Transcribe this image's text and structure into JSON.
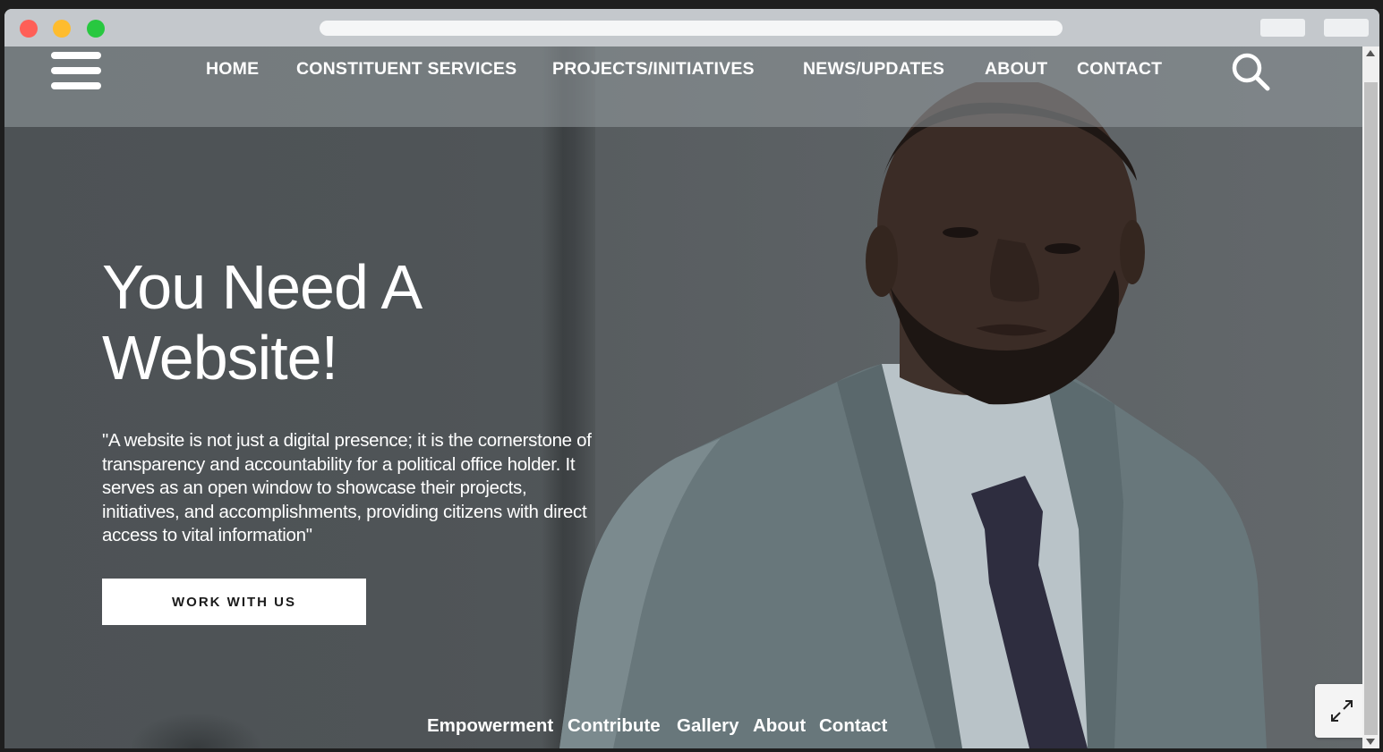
{
  "nav": {
    "items": [
      "HOME",
      "CONSTITUENT SERVICES",
      "PROJECTS/INITIATIVES",
      "NEWS/UPDATES",
      "ABOUT",
      "CONTACT"
    ]
  },
  "hero": {
    "title": "You Need A Website!",
    "quote": "\"A website is not just a digital presence; it is the cornerstone of transparency and accountability for a political office holder. It serves as an open window to showcase their projects, initiatives, and accomplishments, providing citizens with direct access to vital information\"",
    "cta_label": "WORK WITH US"
  },
  "footer": {
    "links": [
      "Empowerment",
      "Contribute",
      "Gallery",
      "About",
      "Contact"
    ]
  },
  "icons": {
    "menu": "hamburger-menu-icon",
    "search": "search-icon",
    "expand": "expand-icon"
  },
  "colors": {
    "overlay": "#4e5356",
    "text": "#ffffff",
    "cta_bg": "#ffffff",
    "cta_text": "#1a1a1a"
  }
}
